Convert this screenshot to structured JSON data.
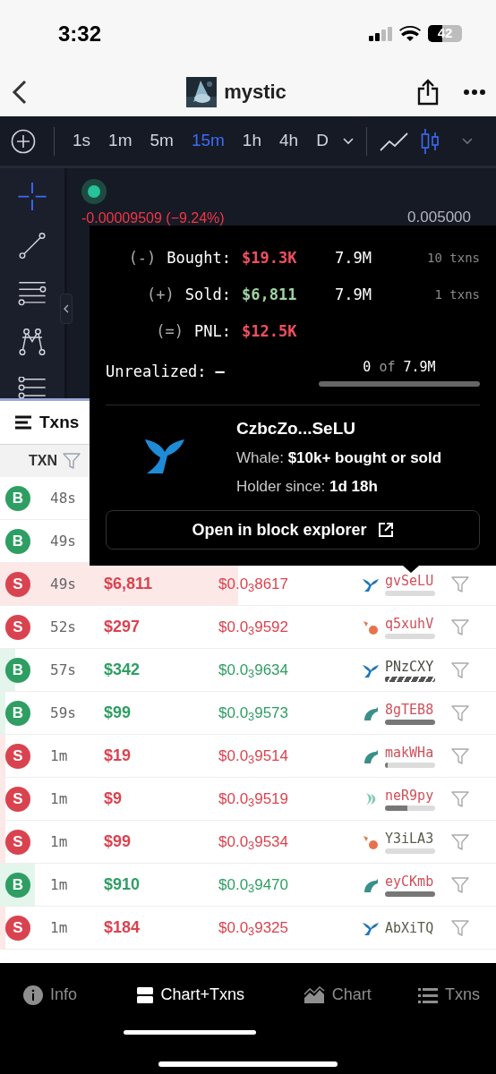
{
  "status_bar": {
    "time": "3:32",
    "battery": "42"
  },
  "header": {
    "title": "mystic"
  },
  "toolbar": {
    "intervals": [
      {
        "label": "1s",
        "selected": false
      },
      {
        "label": "1m",
        "selected": false
      },
      {
        "label": "5m",
        "selected": false
      },
      {
        "label": "15m",
        "selected": true
      },
      {
        "label": "1h",
        "selected": false
      },
      {
        "label": "4h",
        "selected": false
      },
      {
        "label": "D",
        "selected": false
      }
    ],
    "chart_types": [
      {
        "kind": "line",
        "selected": false
      },
      {
        "kind": "candles",
        "selected": true
      }
    ]
  },
  "chart": {
    "change": "-0.00009509 (−9.24%)",
    "price_label": "0.005000"
  },
  "panel": {
    "title": "Txns",
    "column": "TXN"
  },
  "popup": {
    "stats": [
      {
        "sign": "(-)",
        "label": "Bought:",
        "value": "$19.3K",
        "color": "#f0505e",
        "amount": "7.9M",
        "txns": "10 txns"
      },
      {
        "sign": "(+)",
        "label": "Sold:",
        "value": "$6,811",
        "color": "#9fd3a3",
        "amount": "7.9M",
        "txns": "1 txns"
      },
      {
        "sign": "(=)",
        "label": "PNL:",
        "value": "$12.5K",
        "color": "#f0505e"
      }
    ],
    "unrealized": {
      "label": "Unrealized:",
      "value": "–",
      "held": "0",
      "of": "of",
      "total": "7.9M"
    },
    "wallet": "CzbcZo...SeLU",
    "whale": "Whale: **$10k+ bought or sold**",
    "holder": "Holder since: **1d 18h**",
    "button": "Open in block explorer"
  },
  "rows": [
    {
      "side": "B",
      "time": "48s"
    },
    {
      "side": "B",
      "time": "49s"
    },
    {
      "side": "S",
      "time": "49s",
      "amount": "$6,811",
      "price": "$0.0$_{3}$8617",
      "volume": {
        "level": 0.48
      },
      "trader": {
        "kind": "whale",
        "name": "gvSeLU",
        "color": "#d0505a",
        "bar": {
          "kind": "empty"
        }
      }
    },
    {
      "side": "S",
      "time": "52s",
      "amount": "$297",
      "price": "$0.0$_{3}$9592",
      "volume": {
        "level": 0
      },
      "trader": {
        "kind": "shrimp",
        "name": "q5xuhV",
        "color": "#d0505a",
        "bar": {
          "kind": "empty"
        }
      }
    },
    {
      "side": "B",
      "time": "57s",
      "amount": "$342",
      "price": "$0.0$_{3}$9634",
      "volume": {
        "level": 0.03
      },
      "trader": {
        "kind": "whale",
        "name": "PNzCXY",
        "color": "#4a4a44",
        "bar": {
          "kind": "striped",
          "level": 1
        }
      }
    },
    {
      "side": "B",
      "time": "59s",
      "amount": "$99",
      "price": "$0.0$_{3}$9573",
      "volume": {
        "level": 0.01
      },
      "trader": {
        "kind": "dolphin",
        "name": "8gTEB8",
        "color": "#d0505a",
        "bar": {
          "kind": "fill",
          "level": 1
        }
      }
    },
    {
      "side": "S",
      "time": "1m",
      "amount": "$19",
      "price": "$0.0$_{3}$9514",
      "volume": {
        "level": 0.01
      },
      "trader": {
        "kind": "dolphin",
        "name": "makWHa",
        "color": "#d0505a",
        "bar": {
          "kind": "fill",
          "level": 0.05
        }
      }
    },
    {
      "side": "S",
      "time": "1m",
      "amount": "$9",
      "price": "$0.0$_{3}$9519",
      "volume": {
        "level": 0.01
      },
      "trader": {
        "kind": "fish",
        "name": "neR9py",
        "color": "#d0505a",
        "bar": {
          "kind": "fill",
          "level": 0.45
        }
      }
    },
    {
      "side": "S",
      "time": "1m",
      "amount": "$99",
      "price": "$0.0$_{3}$9534",
      "volume": {
        "level": 0.01
      },
      "trader": {
        "kind": "shrimp",
        "name": "Y3iLA3",
        "color": "#5a5a4a",
        "bar": {
          "kind": "empty"
        }
      }
    },
    {
      "side": "B",
      "time": "1m",
      "amount": "$910",
      "price": "$0.0$_{3}$9470",
      "volume": {
        "level": 0.07
      },
      "trader": {
        "kind": "dolphin",
        "name": "eyCKmb",
        "color": "#d0505a",
        "bar": {
          "kind": "fill",
          "level": 1
        }
      }
    },
    {
      "side": "S",
      "time": "1m",
      "amount": "$184",
      "price": "$0.0$_{3}$9325",
      "volume": {
        "level": 0.01
      },
      "trader": {
        "kind": "whale",
        "name": "AbXiTQ",
        "color": "#5a5a4a"
      }
    }
  ],
  "bottom_nav": [
    {
      "kind": "info",
      "label": "Info",
      "selected": false
    },
    {
      "kind": "split",
      "label": "Chart+Txns",
      "selected": true
    },
    {
      "kind": "chart",
      "label": "Chart",
      "selected": false
    },
    {
      "kind": "list",
      "label": "Txns",
      "selected": false
    }
  ]
}
